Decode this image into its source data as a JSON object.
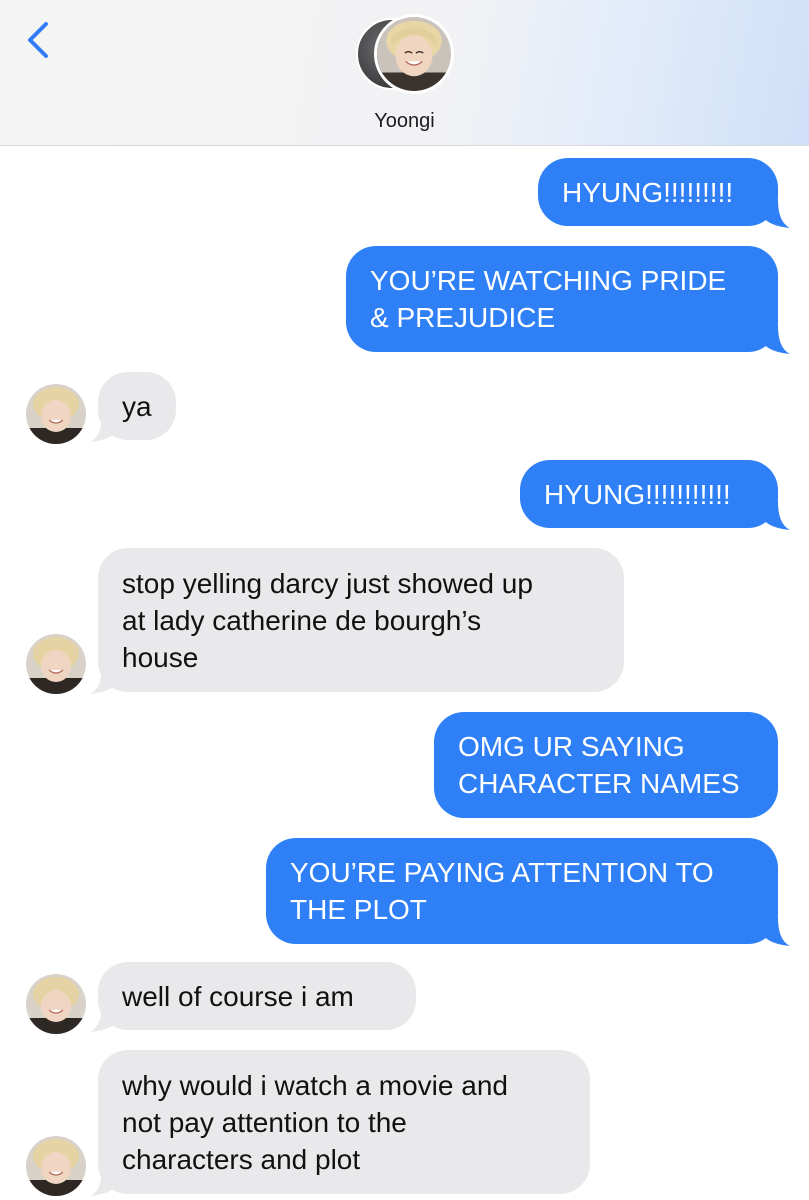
{
  "header": {
    "contact_name": "Yoongi"
  },
  "icons": {
    "back": "chevron-left-icon",
    "avatar": "contact-photo"
  },
  "colors": {
    "outgoing_bubble": "#2f80f6",
    "incoming_bubble": "#e9e9eb",
    "back_chevron": "#2f7df6"
  },
  "messages": [
    {
      "direction": "outgoing",
      "lines": [
        "HYUNG!!!!!!!!!"
      ]
    },
    {
      "direction": "outgoing",
      "lines": [
        "YOU’RE WATCHING PRIDE",
        "& PREJUDICE"
      ]
    },
    {
      "direction": "incoming",
      "lines": [
        "ya"
      ]
    },
    {
      "direction": "outgoing",
      "lines": [
        "HYUNG!!!!!!!!!!!"
      ]
    },
    {
      "direction": "incoming",
      "lines": [
        "stop yelling darcy just showed up",
        "at lady catherine de bourgh’s",
        "house"
      ]
    },
    {
      "direction": "outgoing",
      "lines": [
        "OMG UR SAYING",
        "CHARACTER NAMES"
      ]
    },
    {
      "direction": "outgoing",
      "lines": [
        "YOU’RE PAYING ATTENTION TO",
        "THE PLOT"
      ]
    },
    {
      "direction": "incoming",
      "lines": [
        "well of course i am"
      ]
    },
    {
      "direction": "incoming",
      "lines": [
        "why would i watch a movie and",
        "not pay attention to the",
        "characters and plot"
      ]
    }
  ]
}
